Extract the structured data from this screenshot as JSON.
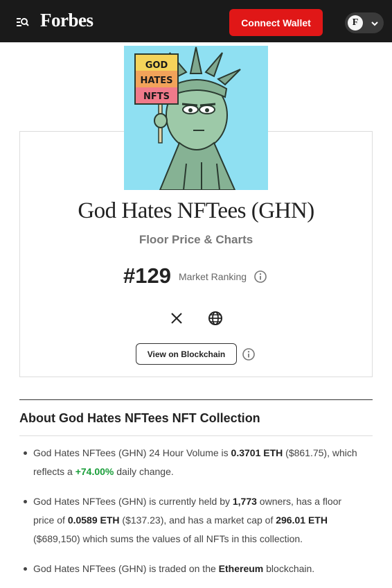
{
  "header": {
    "logo": "Forbes",
    "connect_wallet": "Connect Wallet",
    "account_initial": "F"
  },
  "collection": {
    "title": "God Hates NFTees (GHN)",
    "subtitle": "Floor Price & Charts",
    "rank": "#129",
    "rank_label": "Market Ranking",
    "view_chain_label": "View on Blockchain",
    "image_sign_text": [
      "GOD",
      "HATES",
      "NFTS"
    ]
  },
  "about": {
    "title": "About God Hates NFTees NFT Collection",
    "bullet1": {
      "p1": "God Hates NFTees (GHN) 24 Hour Volume is ",
      "volume": "0.3701 ETH",
      "p2": " ($861.75), which reflects a ",
      "change": "+74.00%",
      "p3": " daily change."
    },
    "bullet2": {
      "p1": "God Hates NFTees (GHN) is currently held by ",
      "owners": "1,773",
      "p2": " owners, has a floor price of ",
      "floor": "0.0589 ETH",
      "p3": " ($137.23), and has a market cap of ",
      "mcap": "296.01 ETH",
      "p4": " ($689,150) which sums the values of all NFTs in this collection."
    },
    "bullet3": {
      "p1": "God Hates NFTees (GHN) is traded on the ",
      "chain": "Ethereum",
      "p2": " blockchain."
    }
  },
  "colors": {
    "header_bg": "#1a1a1a",
    "accent_red": "#e01717",
    "positive_green": "#1a9e3a",
    "hero_bg": "#8fe0f2"
  },
  "icons": [
    "search-menu-icon",
    "chevron-down-icon",
    "info-icon",
    "x-twitter-icon",
    "globe-icon"
  ]
}
